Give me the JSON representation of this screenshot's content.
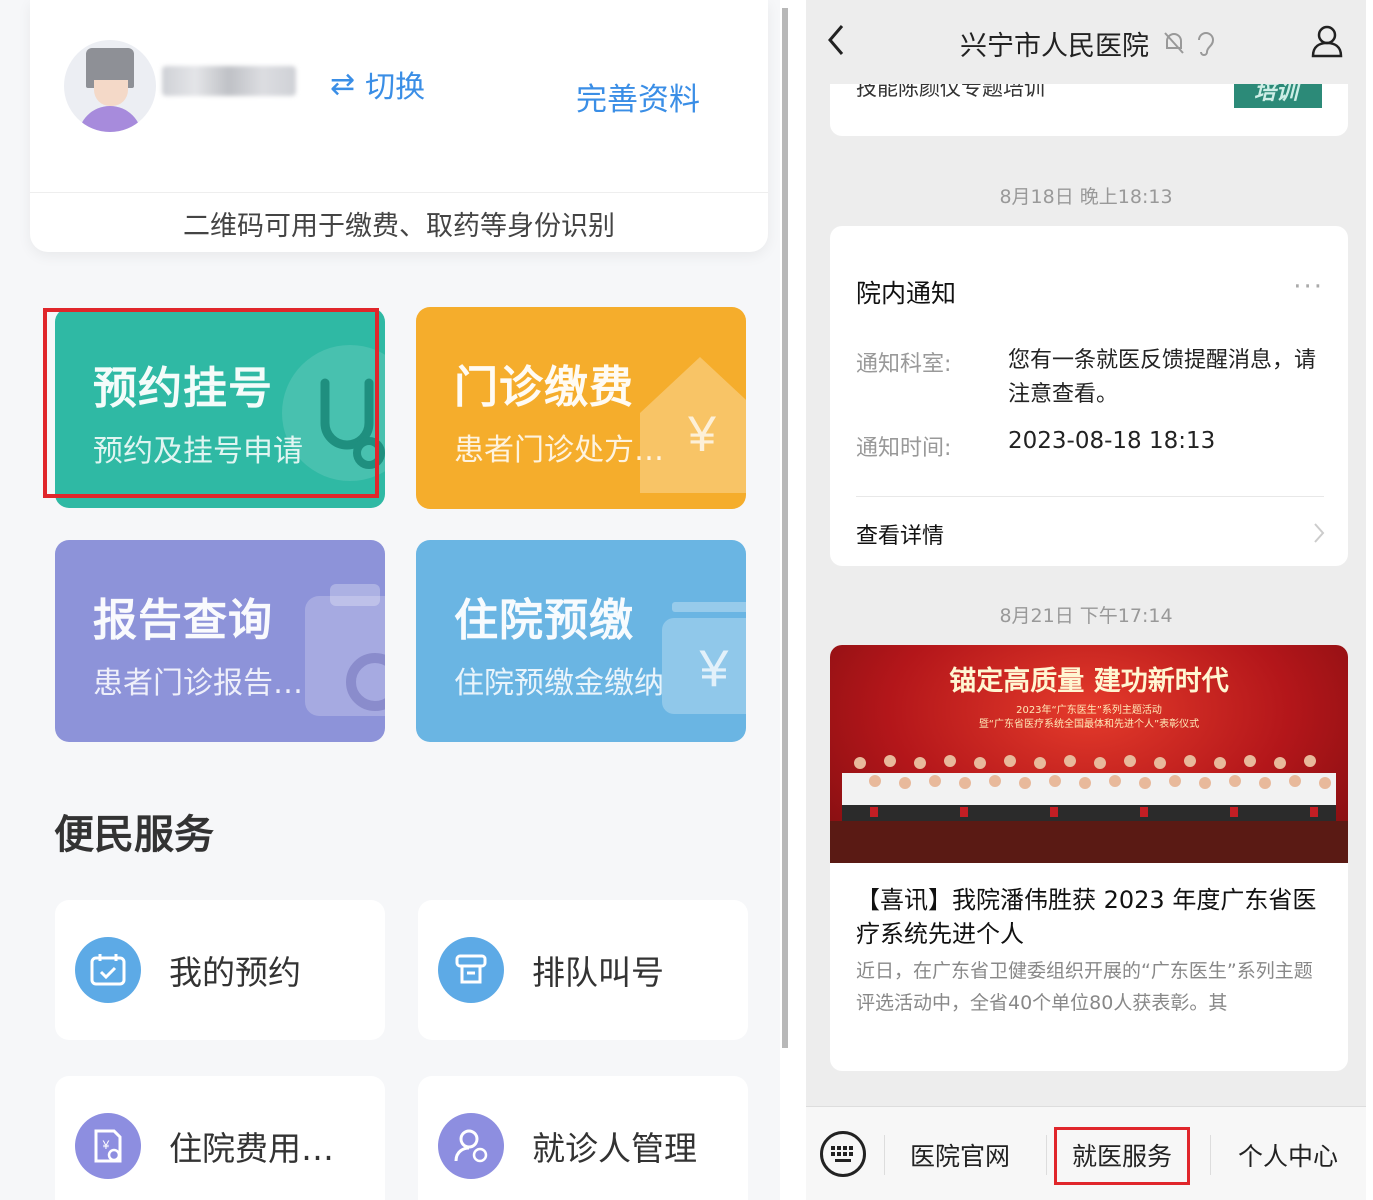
{
  "left": {
    "profile": {
      "switch_icon": "swap-arrows-icon",
      "switch_label": "切换",
      "complete_label": "完善资料",
      "qr_hint": "二维码可用于缴费、取药等身份识别"
    },
    "tiles": [
      {
        "title": "预约挂号",
        "subtitle": "预约及挂号申请",
        "color": "#2fb9a4",
        "icon": "stethoscope-icon"
      },
      {
        "title": "门诊缴费",
        "subtitle": "患者门诊处方…",
        "color": "#f5ad2c",
        "icon": "house-yuan-icon"
      },
      {
        "title": "报告查询",
        "subtitle": "患者门诊报告…",
        "color": "#8d93d9",
        "icon": "clipboard-icon"
      },
      {
        "title": "住院预缴",
        "subtitle": "住院预缴金缴纳",
        "color": "#6ab5e3",
        "icon": "wallet-yuan-icon"
      }
    ],
    "section_title": "便民服务",
    "services": [
      {
        "label": "我的预约",
        "icon": "calendar-check-icon"
      },
      {
        "label": "排队叫号",
        "icon": "ticket-queue-icon"
      },
      {
        "label": "住院费用…",
        "icon": "fee-search-icon"
      },
      {
        "label": "就诊人管理",
        "icon": "patient-manage-icon"
      }
    ],
    "highlight_color": "#e0262b"
  },
  "right": {
    "nav": {
      "title": "兴宁市人民医院",
      "back_icon": "back-chevron-icon",
      "mute_icon": "bell-muted-icon",
      "ear_icon": "ear-icon",
      "profile_icon": "person-icon"
    },
    "top_card": {
      "cut_text": "技能陈颜仪专题培训",
      "thumb_text": "培训"
    },
    "time_1": "8月18日 晚上18:13",
    "notice": {
      "title": "院内通知",
      "more": "···",
      "dept_key": "通知科室:",
      "dept_value": "您有一条就医反馈提醒消息，请注意查看。",
      "time_key": "通知时间:",
      "time_value": "2023-08-18 18:13",
      "detail": "查看详情"
    },
    "time_2": "8月21日 下午17:14",
    "news": {
      "banner": "锚定高质量  建功新时代",
      "banner_small_1": "2023年“广东医生”系列主题活动",
      "banner_small_2": "暨“广东省医疗系统全国最体和先进个人”表彰仪式",
      "title": "【喜讯】我院潘伟胜获 2023 年度广东省医疗系统先进个人",
      "summary": "近日，在广东省卫健委组织开展的“广东医生”系列主题评选活动中，全省40个单位80人获表彰。其"
    },
    "tabbar": {
      "keyboard_icon": "keyboard-icon",
      "tab_site": "医院官网",
      "tab_service": "就医服务",
      "tab_me": "个人中心"
    }
  }
}
